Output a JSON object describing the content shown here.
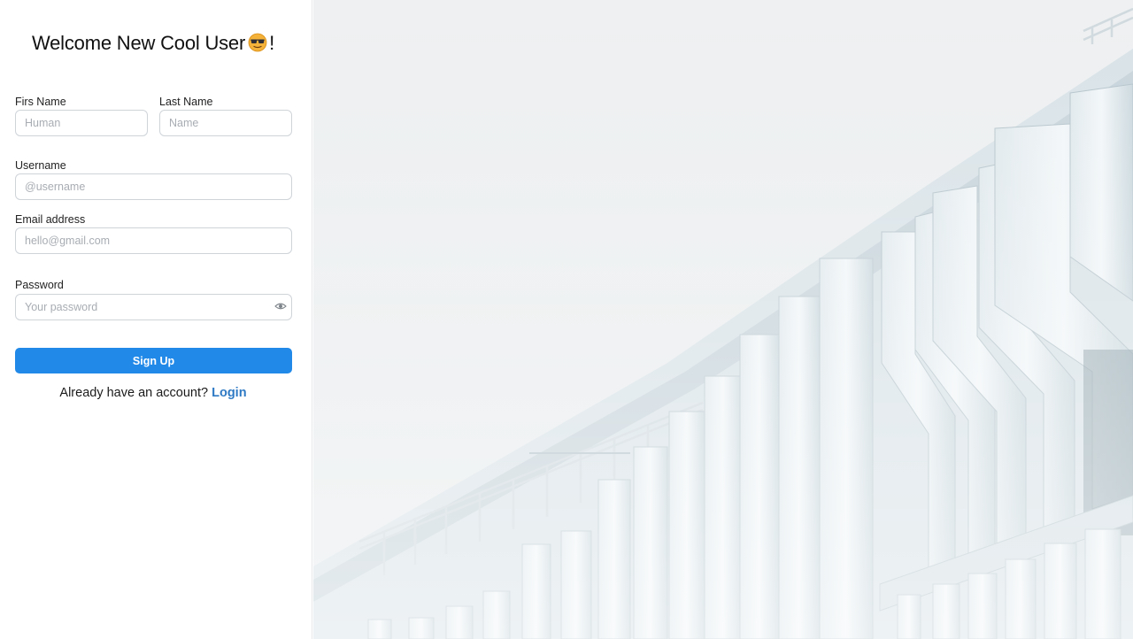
{
  "form": {
    "title": "Welcome New Cool User",
    "title_suffix": "!",
    "title_icon": "sunglasses-emoji-icon",
    "first_name": {
      "label": "Firs Name",
      "placeholder": "Human"
    },
    "last_name": {
      "label": "Last Name",
      "placeholder": "Name"
    },
    "username": {
      "label": "Username",
      "placeholder": "@username"
    },
    "email": {
      "label": "Email address",
      "placeholder": "hello@gmail.com"
    },
    "password": {
      "label": "Password",
      "placeholder": "Your password",
      "toggle_icon": "eye-icon"
    },
    "submit_label": "Sign Up",
    "login_prompt": "Already have an account?",
    "login_link": "Login"
  },
  "colors": {
    "primary": "#2189e8",
    "link": "#2f7ac4",
    "input_border": "#cfd4d9",
    "placeholder": "#a8adb3"
  },
  "hero_image": {
    "subject": "white-architecture-photo"
  }
}
